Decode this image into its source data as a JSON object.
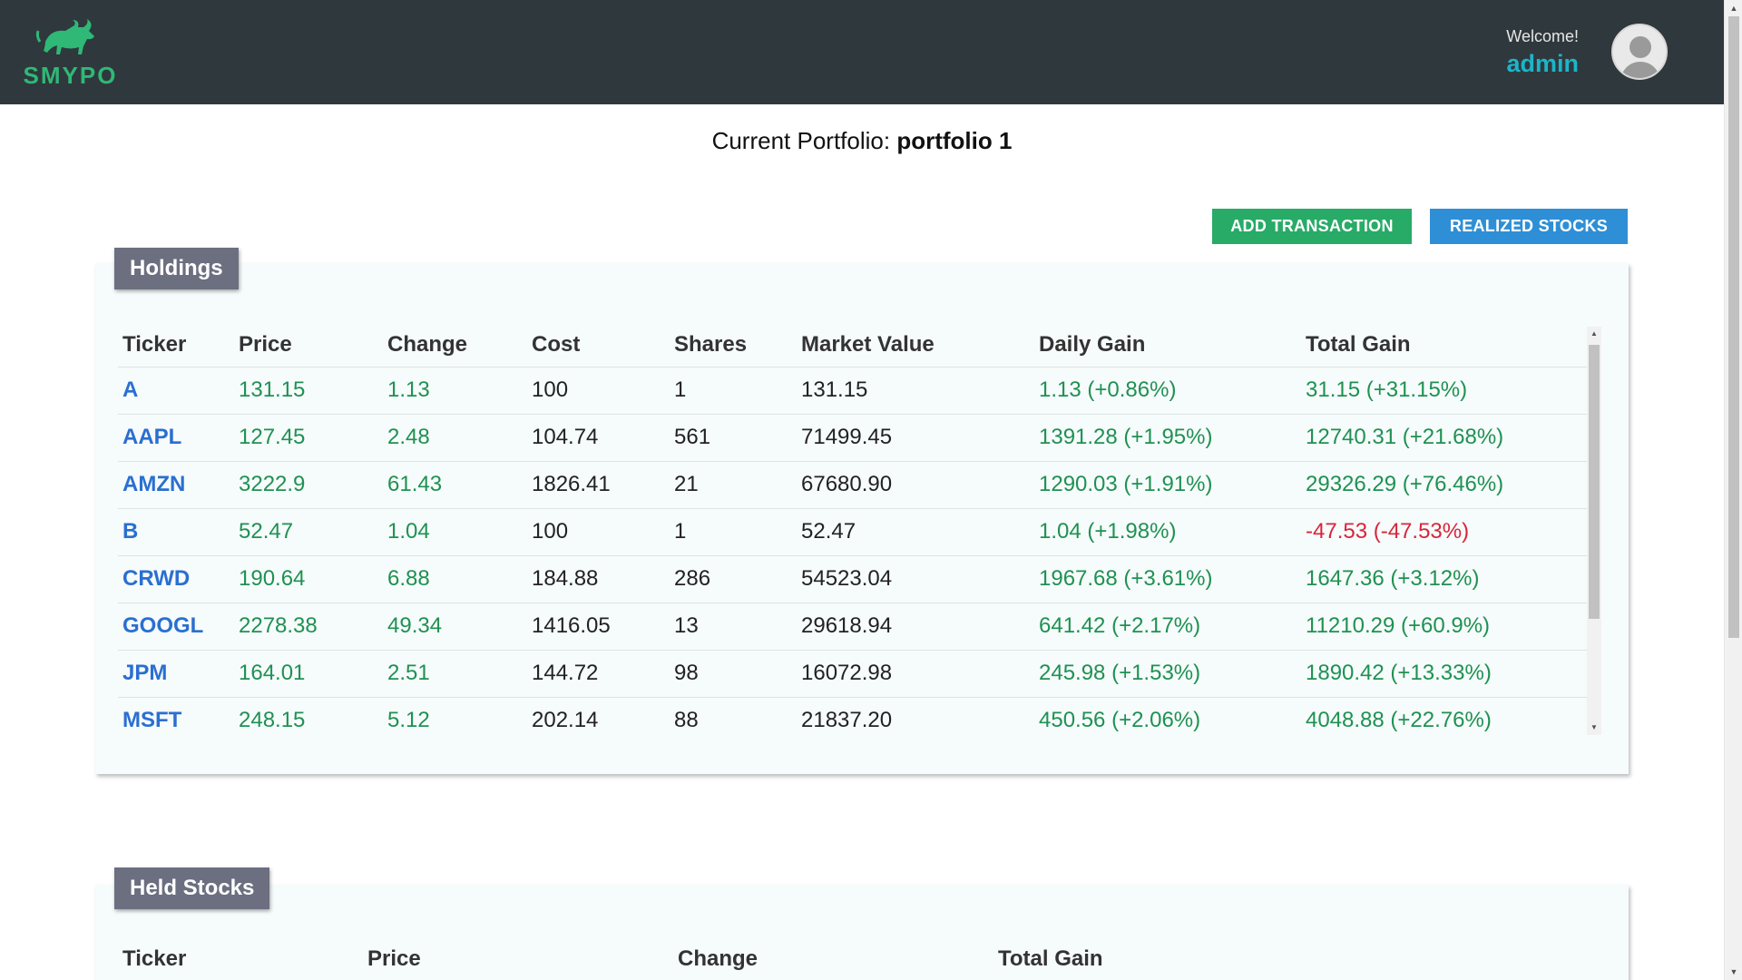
{
  "header": {
    "logo_text": "SMYPO",
    "welcome_label": "Welcome!",
    "username": "admin"
  },
  "portfolio": {
    "prefix": "Current Portfolio:",
    "name": "portfolio 1"
  },
  "buttons": {
    "add_transaction": "ADD TRANSACTION",
    "realized_stocks": "REALIZED STOCKS"
  },
  "holdings": {
    "title": "Holdings",
    "columns": [
      "Ticker",
      "Price",
      "Change",
      "Cost",
      "Shares",
      "Market Value",
      "Daily Gain",
      "Total Gain"
    ],
    "rows": [
      {
        "ticker": "A",
        "price": "131.15",
        "change": "1.13",
        "cost": "100",
        "shares": "1",
        "market_value": "131.15",
        "daily_gain": "1.13 (+0.86%)",
        "total_gain": "31.15 (+31.15%)"
      },
      {
        "ticker": "AAPL",
        "price": "127.45",
        "change": "2.48",
        "cost": "104.74",
        "shares": "561",
        "market_value": "71499.45",
        "daily_gain": "1391.28 (+1.95%)",
        "total_gain": "12740.31 (+21.68%)"
      },
      {
        "ticker": "AMZN",
        "price": "3222.9",
        "change": "61.43",
        "cost": "1826.41",
        "shares": "21",
        "market_value": "67680.90",
        "daily_gain": "1290.03 (+1.91%)",
        "total_gain": "29326.29 (+76.46%)"
      },
      {
        "ticker": "B",
        "price": "52.47",
        "change": "1.04",
        "cost": "100",
        "shares": "1",
        "market_value": "52.47",
        "daily_gain": "1.04 (+1.98%)",
        "total_gain": "-47.53 (-47.53%)"
      },
      {
        "ticker": "CRWD",
        "price": "190.64",
        "change": "6.88",
        "cost": "184.88",
        "shares": "286",
        "market_value": "54523.04",
        "daily_gain": "1967.68 (+3.61%)",
        "total_gain": "1647.36 (+3.12%)"
      },
      {
        "ticker": "GOOGL",
        "price": "2278.38",
        "change": "49.34",
        "cost": "1416.05",
        "shares": "13",
        "market_value": "29618.94",
        "daily_gain": "641.42 (+2.17%)",
        "total_gain": "11210.29 (+60.9%)"
      },
      {
        "ticker": "JPM",
        "price": "164.01",
        "change": "2.51",
        "cost": "144.72",
        "shares": "98",
        "market_value": "16072.98",
        "daily_gain": "245.98 (+1.53%)",
        "total_gain": "1890.42 (+13.33%)"
      },
      {
        "ticker": "MSFT",
        "price": "248.15",
        "change": "5.12",
        "cost": "202.14",
        "shares": "88",
        "market_value": "21837.20",
        "daily_gain": "450.56 (+2.06%)",
        "total_gain": "4048.88 (+22.76%)"
      }
    ]
  },
  "held_stocks": {
    "title": "Held Stocks",
    "columns": [
      "Ticker",
      "Price",
      "Change",
      "Total Gain"
    ]
  },
  "colors": {
    "header_bg": "#2f383d",
    "brand_green": "#2fb876",
    "username": "#1cb5c9",
    "add_button": "#27ab67",
    "realized_button": "#2e8fd6",
    "positive": "#1f9152",
    "negative": "#d9253a",
    "ticker_link": "#2a6fd1",
    "card_label_bg": "#6c6f80"
  },
  "icons": {
    "logo": "bull-logo-icon",
    "avatar": "user-avatar-icon",
    "scroll_up": "scroll-up-arrow-icon",
    "scroll_down": "scroll-down-arrow-icon"
  }
}
